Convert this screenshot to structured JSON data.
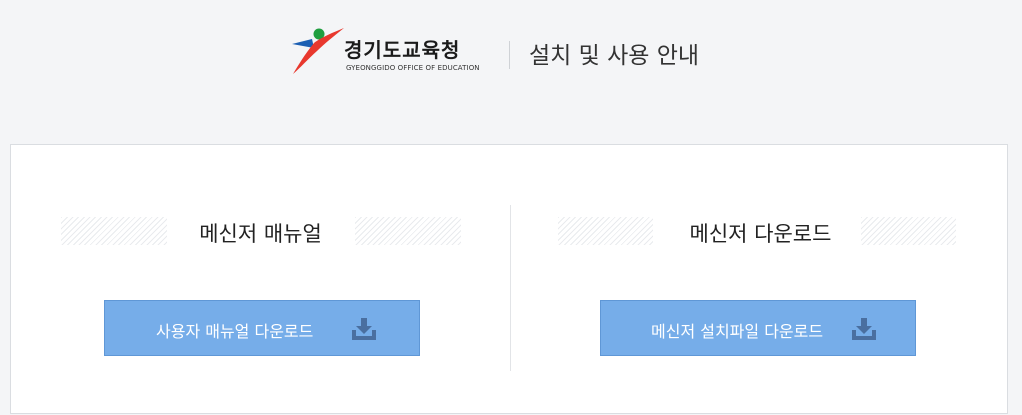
{
  "header": {
    "logo_name": "경기도교육청",
    "logo_subtitle": "GYEONGGIDO OFFICE OF EDUCATION",
    "title": "설치 및 사용 안내"
  },
  "sections": [
    {
      "title": "메신저 매뉴얼",
      "button_label": "사용자 매뉴얼 다운로드",
      "button_icon": "download-icon"
    },
    {
      "title": "메신저 다운로드",
      "button_label": "메신저 설치파일 다운로드",
      "button_icon": "download-icon"
    }
  ],
  "colors": {
    "background": "#f4f5f7",
    "button": "#76ade9",
    "button_border": "#5f97d6",
    "icon": "#4a6fa0",
    "logo_red": "#e8382e",
    "logo_green": "#1f9e3f",
    "logo_blue": "#1c5fb3"
  }
}
